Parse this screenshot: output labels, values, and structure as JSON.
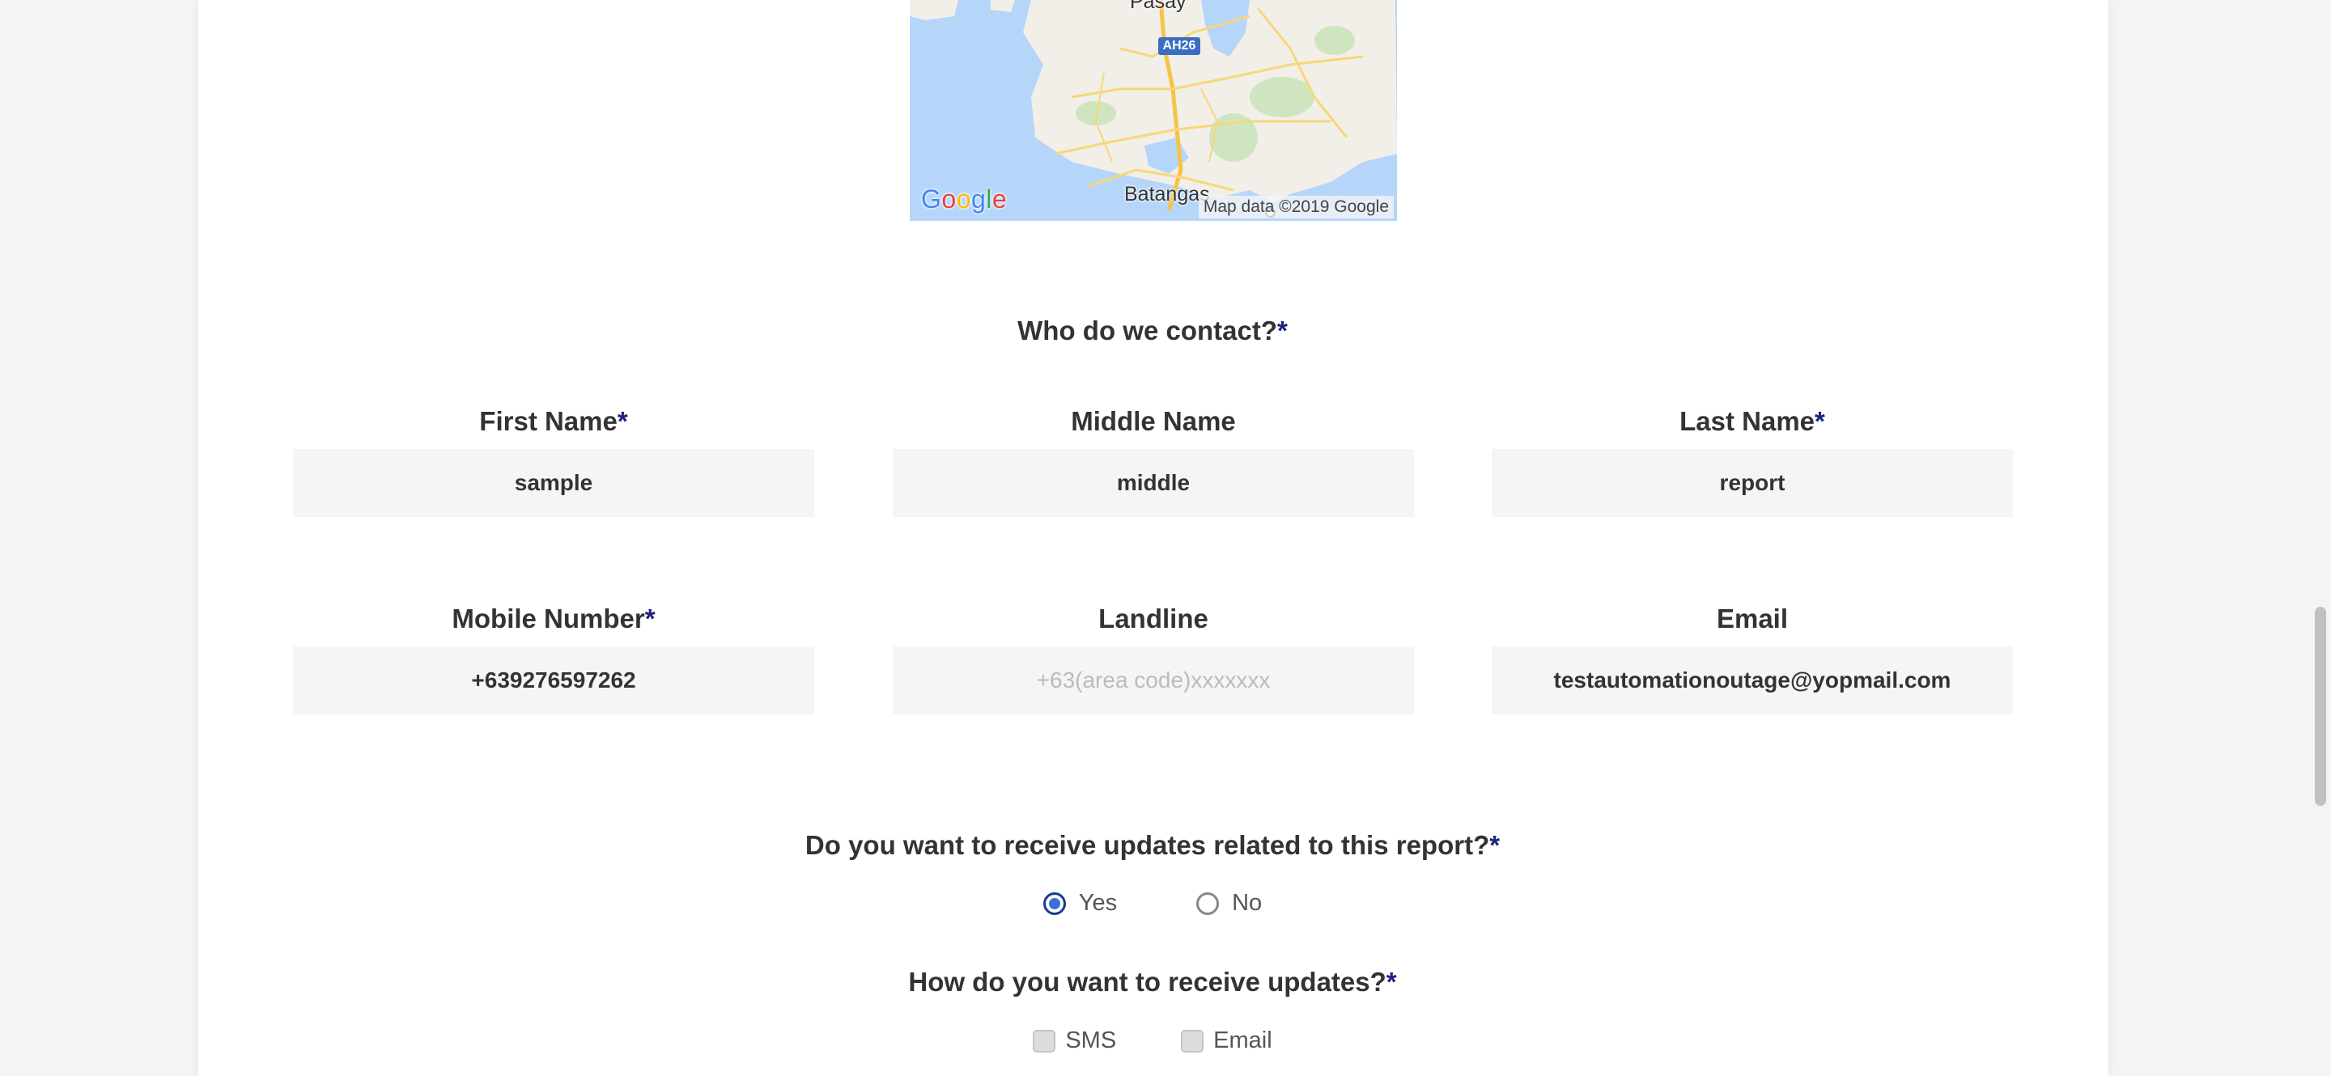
{
  "map": {
    "logo": "Google",
    "attribution": "Map data ©2019 Google",
    "city_top": "Pasay",
    "city_bottom": "Batangas",
    "route_shield": "AH26"
  },
  "contact_section": {
    "heading": "Who do we contact?",
    "required_mark": "*"
  },
  "fields": {
    "first_name": {
      "label": "First Name",
      "required": "*",
      "value": "sample"
    },
    "middle_name": {
      "label": "Middle Name",
      "value": "middle"
    },
    "last_name": {
      "label": "Last Name",
      "required": "*",
      "value": "report"
    },
    "mobile_number": {
      "label": "Mobile Number",
      "required": "*",
      "value": "+639276597262"
    },
    "landline": {
      "label": "Landline",
      "value": "",
      "placeholder": "+63(area code)xxxxxxx"
    },
    "email": {
      "label": "Email",
      "value": "testautomationoutage@yopmail.com"
    }
  },
  "updates_question": {
    "heading": "Do you want to receive updates related to this report?",
    "required_mark": "*",
    "options": [
      {
        "label": "Yes",
        "selected": true
      },
      {
        "label": "No",
        "selected": false
      }
    ]
  },
  "updates_method": {
    "heading": "How do you want to receive updates?",
    "required_mark": "*",
    "options": [
      {
        "label": "SMS",
        "checked": false
      },
      {
        "label": "Email",
        "checked": false
      }
    ]
  },
  "colors": {
    "required_asterisk": "#1a237e",
    "input_background": "#f5f5f5",
    "radio_selected": "#3b6fd6"
  }
}
